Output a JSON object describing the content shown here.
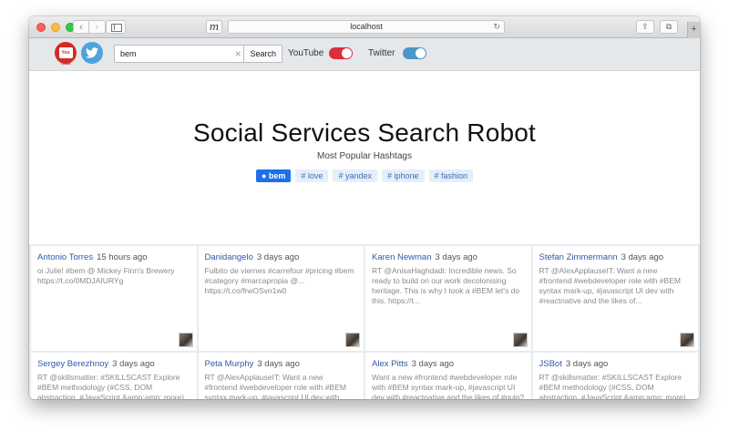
{
  "browser": {
    "url": "localhost",
    "favicon_glyph": "m"
  },
  "header": {
    "search_value": "bem",
    "search_button": "Search",
    "youtube_label": "YouTube",
    "twitter_label": "Twitter",
    "youtube_enabled": true,
    "twitter_enabled": true,
    "youtube_icon_text": "You Tube",
    "colors": {
      "youtube": "#d22b25",
      "twitter": "#4fa2da"
    }
  },
  "hero": {
    "title": "Social Services Search Robot",
    "subtitle": "Most Popular Hashtags",
    "tags": [
      {
        "label": "● bem",
        "active": true
      },
      {
        "label": "# love",
        "active": false
      },
      {
        "label": "# yandex",
        "active": false
      },
      {
        "label": "# iphone",
        "active": false
      },
      {
        "label": "# fashion",
        "active": false
      }
    ]
  },
  "cards": [
    {
      "author": "Antonio Torres",
      "time": "15 hours ago",
      "text": "oi Julie! #bem @ Mickey Finn's Brewery https://t.co/0MDJAIURYg"
    },
    {
      "author": "Danidangelo",
      "time": "3 days ago",
      "text": "Fulbito de viernes #carrefour #pricing #bem #category #marcapropia @... https://t.co/frwOSvn1w0"
    },
    {
      "author": "Karen Newman",
      "time": "3 days ago",
      "text": "RT @AnisaHaghdadi: Incredible news. So ready to build on our work decolonising heritage. This is why I took a #BEM let's do this. https://t..."
    },
    {
      "author": "Stefan Zimmermann",
      "time": "3 days ago",
      "text": "RT @AlexApplauseIT: Want a new #frontend #webdeveloper role with #BEM syntax mark-up, #javascript UI dev with #reactnative and the likes of..."
    },
    {
      "author": "Sergey Berezhnoy",
      "time": "3 days ago",
      "text": "RT @skillsmatter: #SKILLSCAST Explore #BEM methodology (#CSS, DOM abstraction, #JavaScript &amp;amp; more) w- @tadatuta"
    },
    {
      "author": "Peta Murphy",
      "time": "3 days ago",
      "text": "RT @AlexApplauseIT: Want a new #frontend #webdeveloper role with #BEM syntax mark-up, #javascript UI dev with #reactnative and"
    },
    {
      "author": "Alex Pitts",
      "time": "3 days ago",
      "text": "Want a new #frontend #webdeveloper role with #BEM syntax mark-up, #javascript UI dev with #reactnative and the likes of #gulp?"
    },
    {
      "author": "JSBot",
      "time": "3 days ago",
      "text": "RT @skillsmatter: #SKILLSCAST Explore #BEM methodology (#CSS, DOM abstraction, #JavaScript &amp;amp; more) w- @tadatuta"
    }
  ]
}
